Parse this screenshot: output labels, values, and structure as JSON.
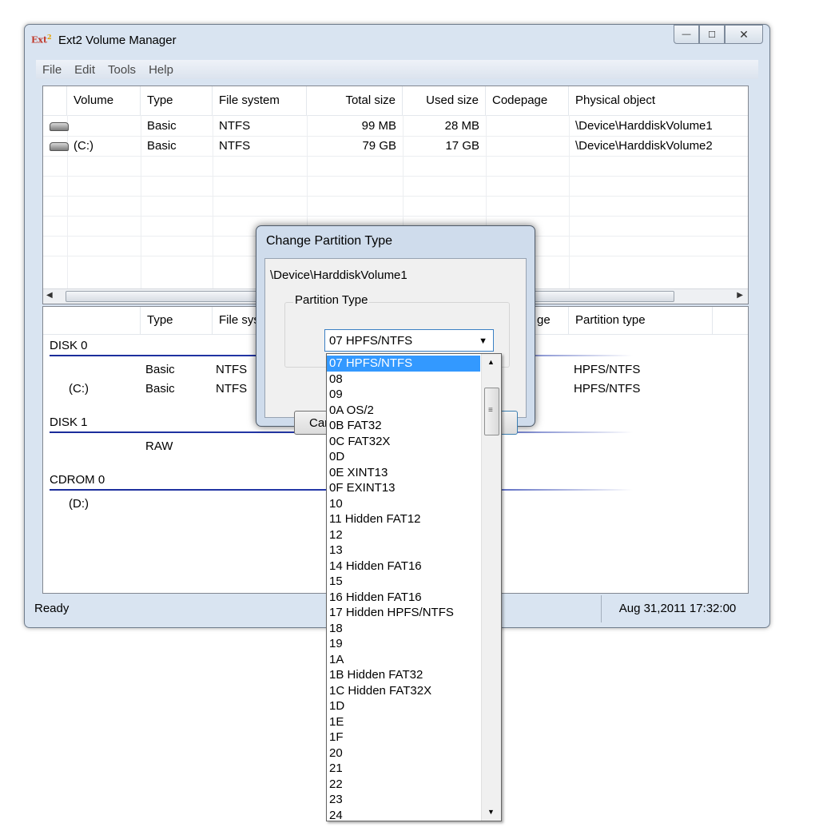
{
  "window": {
    "icon_text": "Ext",
    "icon_mark": "2",
    "title": "Ext2 Volume Manager",
    "caption_buttons": {
      "minimize": "—",
      "maximize": "☐",
      "close": "✕"
    }
  },
  "menu": [
    "File",
    "Edit",
    "Tools",
    "Help"
  ],
  "volumes": {
    "columns": [
      "Volume",
      "Type",
      "File system",
      "Total size",
      "Used size",
      "Codepage",
      "Physical object"
    ],
    "rows": [
      {
        "icon": "disk-icon",
        "volume": "",
        "type": "Basic",
        "fs": "NTFS",
        "total": "99 MB",
        "used": "28 MB",
        "codepage": "",
        "physical": "\\Device\\HarddiskVolume1"
      },
      {
        "icon": "disk-icon",
        "volume": "(C:)",
        "type": "Basic",
        "fs": "NTFS",
        "total": "79 GB",
        "used": "17 GB",
        "codepage": "",
        "physical": "\\Device\\HarddiskVolume2"
      }
    ],
    "scroll_left": "◀",
    "scroll_right": "▶"
  },
  "disks": {
    "columns": [
      "Type",
      "File sys",
      "ge",
      "Partition type"
    ],
    "groups": [
      {
        "label": "DISK 0",
        "rows": [
          {
            "volume": "",
            "type": "Basic",
            "fs": "NTFS",
            "ptype": "HPFS/NTFS"
          },
          {
            "volume": "(C:)",
            "type": "Basic",
            "fs": "NTFS",
            "ptype": "HPFS/NTFS"
          }
        ]
      },
      {
        "label": "DISK 1",
        "rows": [
          {
            "volume": "",
            "type": "RAW",
            "fs": "",
            "ptype": ""
          }
        ]
      },
      {
        "label": "CDROM 0",
        "rows": [
          {
            "volume": "(D:)",
            "type": "",
            "fs": "",
            "ptype": ""
          }
        ]
      }
    ]
  },
  "status": {
    "left": "Ready",
    "right": "Aug 31,2011 17:32:00"
  },
  "dialog": {
    "title": "Change Partition Type",
    "device": "\\Device\\HarddiskVolume1",
    "group_label": "Partition Type",
    "selected": "07 HPFS/NTFS",
    "cancel_label": "Canc",
    "ok_label": "",
    "caret": "▼"
  },
  "dropdown": {
    "options": [
      "07 HPFS/NTFS",
      "08",
      "09",
      "0A OS/2",
      "0B FAT32",
      "0C FAT32X",
      "0D",
      "0E XINT13",
      "0F EXINT13",
      "10",
      "11 Hidden FAT12",
      "12",
      "13",
      "14 Hidden FAT16",
      "15",
      "16 Hidden FAT16",
      "17 Hidden HPFS/NTFS",
      "18",
      "19",
      "1A",
      "1B Hidden FAT32",
      "1C Hidden FAT32X",
      "1D",
      "1E",
      "1F",
      "20",
      "21",
      "22",
      "23",
      "24"
    ],
    "selected_index": 0,
    "scroll_up": "▲",
    "scroll_down": "▼",
    "grip": "≡"
  }
}
